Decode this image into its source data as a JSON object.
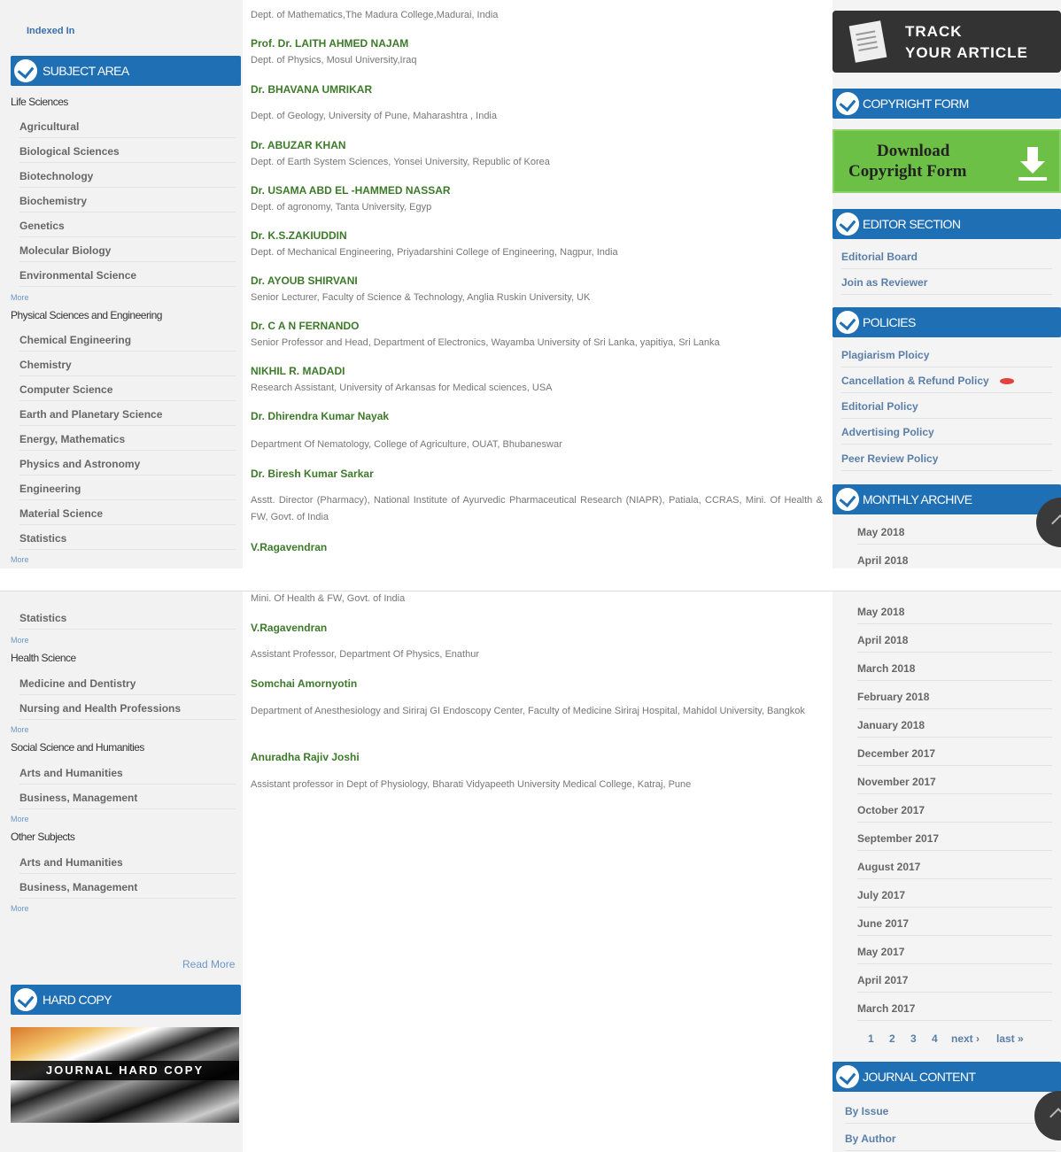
{
  "left_top": {
    "indexed_in": "Indexed In",
    "subject_area_title": "SUBJECT AREA",
    "life_sciences": "Life Sciences",
    "life_items": [
      "Agricultural",
      "Biological Sciences",
      "Biotechnology",
      "Biochemistry",
      "Genetics",
      "Molecular Biology",
      "Environmental Science"
    ],
    "more": "More",
    "physical": "Physical Sciences and Engineering",
    "physical_items": [
      "Chemical Engineering",
      "Chemistry",
      "Computer Science",
      "Earth and Planetary Science",
      "Energy, Mathematics",
      "Physics and Astronomy",
      "Engineering",
      "Material Science",
      "Statistics"
    ]
  },
  "left_bottom": {
    "statistics": "Statistics",
    "more": "More",
    "health": "Health Science",
    "health_items": [
      "Medicine and Dentistry",
      "Nursing and Health Professions"
    ],
    "social": "Social Science and Humanities",
    "social_items": [
      "Arts and Humanities",
      "Business, Management"
    ],
    "other": "Other Subjects",
    "other_items": [
      "Arts and Humanities",
      "Business, Management"
    ],
    "read_more": "Read More",
    "hard_copy_title": "HARD COPY",
    "hard_copy_banner": "JOURNAL HARD COPY"
  },
  "editors_top": [
    {
      "name": "",
      "aff": "Dept. of Mathematics,The Madura College,Madurai, India"
    },
    {
      "name": "Prof. Dr. LAITH AHMED NAJAM",
      "aff": "Dept. of Physics, Mosul University,Iraq"
    },
    {
      "name": "Dr. BHAVANA UMRIKAR",
      "aff": "Dept. of Geology, University of Pune, Maharashtra , India"
    },
    {
      "name": "Dr. ABUZAR KHAN",
      "aff": "Dept. of Earth System Sciences, Yonsei University, Republic of Korea"
    },
    {
      "name": "Dr. USAMA ABD EL -HAMMED NASSAR",
      "aff": "Dept. of agronomy, Tanta University, Egyp"
    },
    {
      "name": "Dr. K.S.ZAKIUDDIN",
      "aff": "Dept. of Mechanical Engineering, Priyadarshini College of Engineering, Nagpur, India"
    },
    {
      "name": "Dr. AYOUB SHIRVANI",
      "aff": "Senior Lecturer, Faculty of Science & Technology, Anglia Ruskin University, UK"
    },
    {
      "name": "Dr. C A N FERNANDO",
      "aff": "Senior Professor and Head, Department of Electronics, Wayamba University of Sri Lanka, yapitiya, Sri Lanka"
    },
    {
      "name": "NIKHIL R. MADADI",
      "aff": "Research Assistant, University of Arkansas for Medical sciences, USA"
    },
    {
      "name": "Dr. Dhirendra Kumar Nayak",
      "aff": "Department Of Nematology, College of Agriculture, OUAT, Bhubaneswar"
    },
    {
      "name": "Dr. Biresh Kumar Sarkar",
      "aff": "Asstt. Director (Pharmacy), National Institute of Ayurvedic Pharmaceutical Research (NIAPR), Patiala, CCRAS, Mini. Of Health & FW, Govt. of India"
    },
    {
      "name": "V.Ragavendran",
      "aff": ""
    }
  ],
  "editors_bottom": [
    {
      "name": "",
      "aff": "Mini. Of Health & FW, Govt. of India"
    },
    {
      "name": "V.Ragavendran",
      "aff": "Assistant Professor, Department Of Physics, Enathur"
    },
    {
      "name": "Somchai Amornyotin",
      "aff": "Department of Anesthesiology and Siriraj GI Endoscopy Center, Faculty of Medicine Siriraj Hospital, Mahidol University, Bangkok"
    },
    {
      "name": "Anuradha Rajiv Joshi",
      "aff": "Assistant professor in Dept of Physiology, Bharati Vidyapeeth University Medical College, Katraj, Pune"
    }
  ],
  "right_top": {
    "track_line1": "TRACK",
    "track_line2": "YOUR ARTICLE",
    "copyright_title": "COPYRIGHT FORM",
    "download_line1": "Download",
    "download_line2": "Copyright Form",
    "editor_title": "EDITOR SECTION",
    "editor_links": [
      "Editorial Board",
      "Join as Reviewer"
    ],
    "policies_title": "POLICIES",
    "policy_links": [
      "Plagiarism Ploicy",
      "Cancellation & Refund Policy",
      "Editorial Policy",
      "Advertising Policy",
      "Peer Review Policy"
    ],
    "archive_title": "MONTHLY ARCHIVE",
    "archive_months": [
      "May 2018",
      "April 2018"
    ]
  },
  "right_bottom": {
    "months": [
      "May 2018",
      "April 2018",
      "March 2018",
      "February 2018",
      "January 2018",
      "December 2017",
      "November 2017",
      "October 2017",
      "September 2017",
      "August 2017",
      "July 2017",
      "June 2017",
      "May 2017",
      "April 2017",
      "March 2017"
    ],
    "pager": [
      "1",
      "2",
      "3",
      "4",
      "next ›",
      "last »"
    ],
    "journal_content_title": "JOURNAL CONTENT",
    "journal_links": [
      "By Issue",
      "By Author"
    ]
  },
  "colors": {
    "header_blue": "#1f6fb5",
    "name_green": "#3c7a2a",
    "download_green": "#6cc045"
  }
}
